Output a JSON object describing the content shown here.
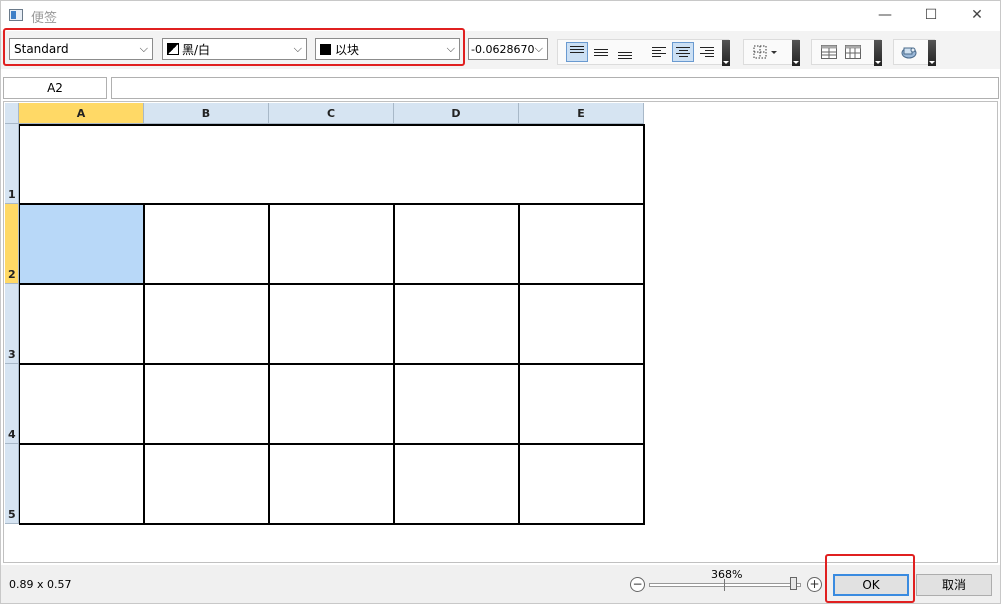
{
  "window": {
    "title": "便签",
    "minimize_glyph": "—",
    "maximize_glyph": "☐",
    "close_glyph": "✕"
  },
  "toolbar": {
    "style_combo": "Standard",
    "color_combo": "黑/白",
    "block_combo": "以块",
    "angle_combo": "-0.0628670",
    "icons": [
      "align-top-icon",
      "align-middle-icon",
      "align-bottom-icon",
      "align-left-icon",
      "align-center-icon",
      "align-right-icon",
      "borders-icon",
      "insert-rows-icon",
      "insert-columns-icon",
      "table-style-icon"
    ]
  },
  "formula_bar": {
    "cell_ref": "A2",
    "value": ""
  },
  "grid": {
    "columns": [
      "A",
      "B",
      "C",
      "D",
      "E"
    ],
    "rows": [
      "1",
      "2",
      "3",
      "4",
      "5"
    ],
    "selected_cell": "A2"
  },
  "status": {
    "size": "0.89 x 0.57",
    "zoom": "368%",
    "zoom_level": 0.97,
    "ok_label": "OK",
    "cancel_label": "取消"
  },
  "colors": {
    "highlight_red": "#e02020",
    "selected_header": "#ffd966",
    "selected_cell": "#b8d8f8",
    "header_bg": "#d6e4f2"
  }
}
